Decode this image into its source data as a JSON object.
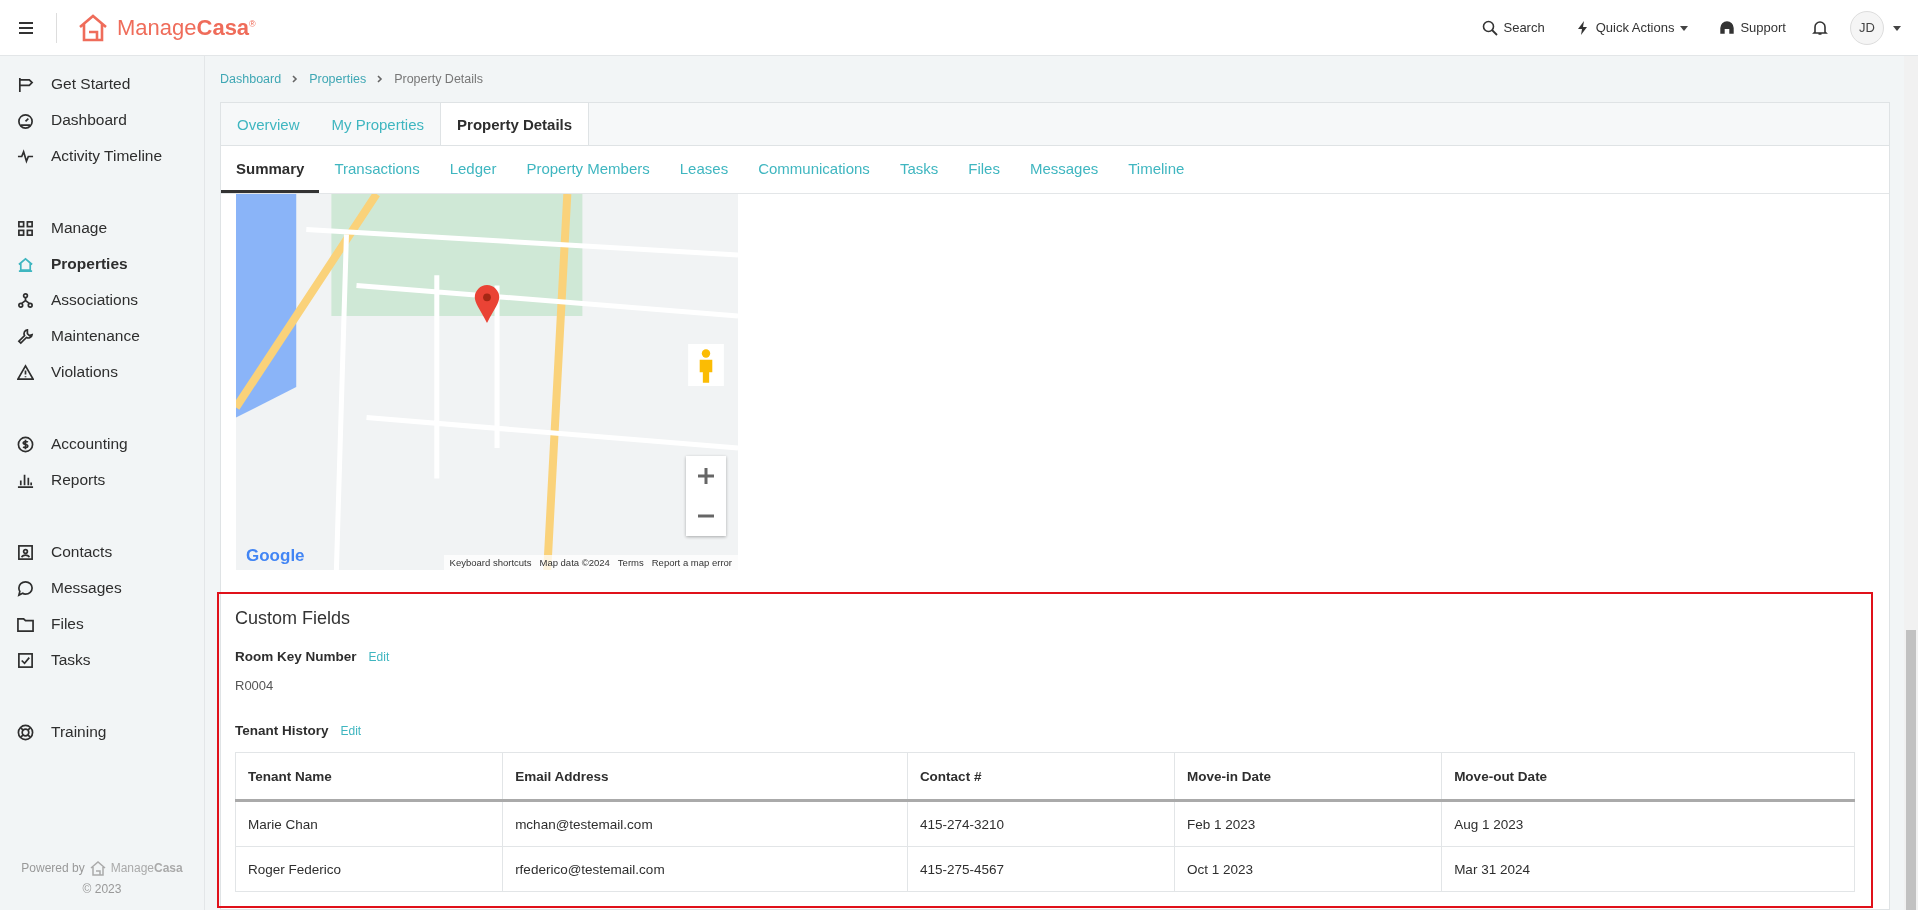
{
  "header": {
    "brand": {
      "name_light": "Manage",
      "name_bold": "Casa",
      "mark": "®"
    },
    "search": "Search",
    "quick_actions": "Quick Actions",
    "support": "Support",
    "avatar": "JD"
  },
  "sidebar": {
    "groups": [
      [
        {
          "label": "Get Started",
          "selected": false
        },
        {
          "label": "Dashboard",
          "selected": false
        },
        {
          "label": "Activity Timeline",
          "selected": false
        }
      ],
      [
        {
          "label": "Manage",
          "selected": false
        },
        {
          "label": "Properties",
          "selected": true
        },
        {
          "label": "Associations",
          "selected": false
        },
        {
          "label": "Maintenance",
          "selected": false
        },
        {
          "label": "Violations",
          "selected": false
        }
      ],
      [
        {
          "label": "Accounting",
          "selected": false
        },
        {
          "label": "Reports",
          "selected": false
        }
      ],
      [
        {
          "label": "Contacts",
          "selected": false
        },
        {
          "label": "Messages",
          "selected": false
        },
        {
          "label": "Files",
          "selected": false
        },
        {
          "label": "Tasks",
          "selected": false
        }
      ],
      [
        {
          "label": "Training",
          "selected": false
        }
      ]
    ],
    "footer": {
      "powered_by": "Powered by",
      "brand_light": "Manage",
      "brand_bold": "Casa",
      "copyright": "© 2023"
    }
  },
  "breadcrumb": [
    "Dashboard",
    "Properties",
    "Property Details"
  ],
  "tabs": [
    {
      "label": "Overview",
      "selected": false
    },
    {
      "label": "My Properties",
      "selected": false
    },
    {
      "label": "Property Details",
      "selected": true
    }
  ],
  "subtabs": [
    {
      "label": "Summary",
      "selected": true
    },
    {
      "label": "Transactions",
      "selected": false
    },
    {
      "label": "Ledger",
      "selected": false
    },
    {
      "label": "Property Members",
      "selected": false
    },
    {
      "label": "Leases",
      "selected": false
    },
    {
      "label": "Communications",
      "selected": false
    },
    {
      "label": "Tasks",
      "selected": false
    },
    {
      "label": "Files",
      "selected": false
    },
    {
      "label": "Messages",
      "selected": false
    },
    {
      "label": "Timeline",
      "selected": false
    }
  ],
  "map": {
    "logo": "Google",
    "attribution": [
      "Keyboard shortcuts",
      "Map data ©2024",
      "Terms",
      "Report a map error"
    ]
  },
  "custom_fields": {
    "title": "Custom Fields",
    "fields": [
      {
        "label": "Room Key Number",
        "action": "Edit",
        "value": "R0004"
      }
    ],
    "table_field": {
      "label": "Tenant History",
      "action": "Edit",
      "columns": [
        "Tenant Name",
        "Email Address",
        "Contact #",
        "Move-in Date",
        "Move-out Date"
      ],
      "rows": [
        [
          "Marie Chan",
          "mchan@testemail.com",
          "415-274-3210",
          "Feb 1 2023",
          "Aug 1 2023"
        ],
        [
          "Roger Federico",
          "rfederico@testemail.com",
          "415-275-4567",
          "Oct 1 2023",
          "Mar 31 2024"
        ]
      ]
    }
  }
}
